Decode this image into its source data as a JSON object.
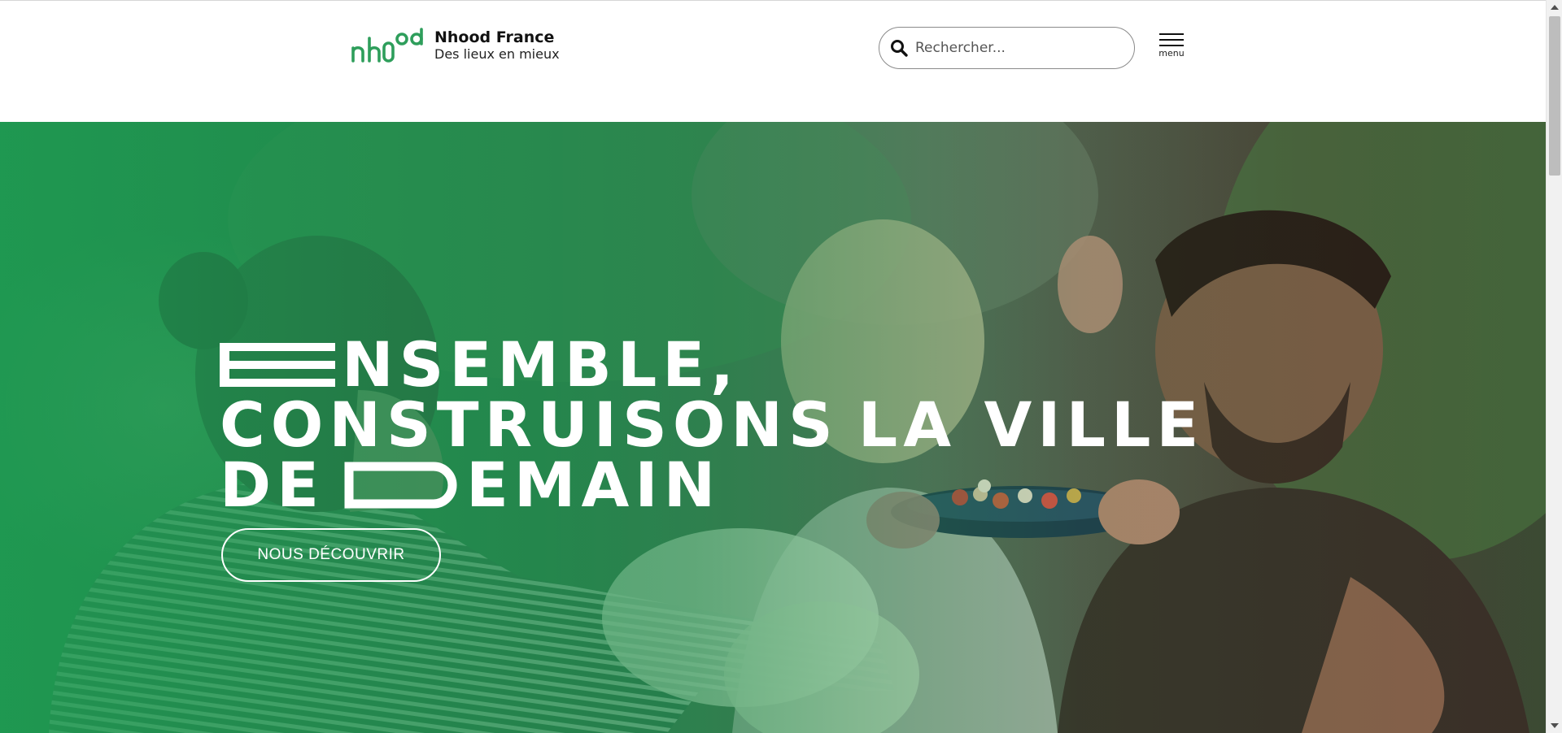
{
  "header": {
    "brand_name": "Nhood France",
    "brand_tagline": "Des lieux en mieux",
    "logo_text": "nhood",
    "search_placeholder": "Rechercher...",
    "menu_label": "menu"
  },
  "hero": {
    "headline_line1": "NSEMBLE,",
    "headline_line2_word1": "CONSTRUISONS",
    "headline_line2_word2": "LA VILLE",
    "headline_line3_prefix": "DE",
    "headline_line3_suffix": "EMAIN",
    "cta_label": "NOUS DÉCOUVRIR",
    "image_description": "Group of people sharing food at an outdoor gathering, green-tinted photo"
  },
  "colors": {
    "brand_green": "#2e9e5b",
    "hero_overlay_green": "#1f8a4c",
    "text_dark": "#111111",
    "white": "#ffffff"
  },
  "icons": {
    "search": "search-icon",
    "menu": "hamburger-icon",
    "scroll_up": "scroll-up-arrow-icon",
    "scroll_down": "scroll-down-arrow-icon"
  }
}
